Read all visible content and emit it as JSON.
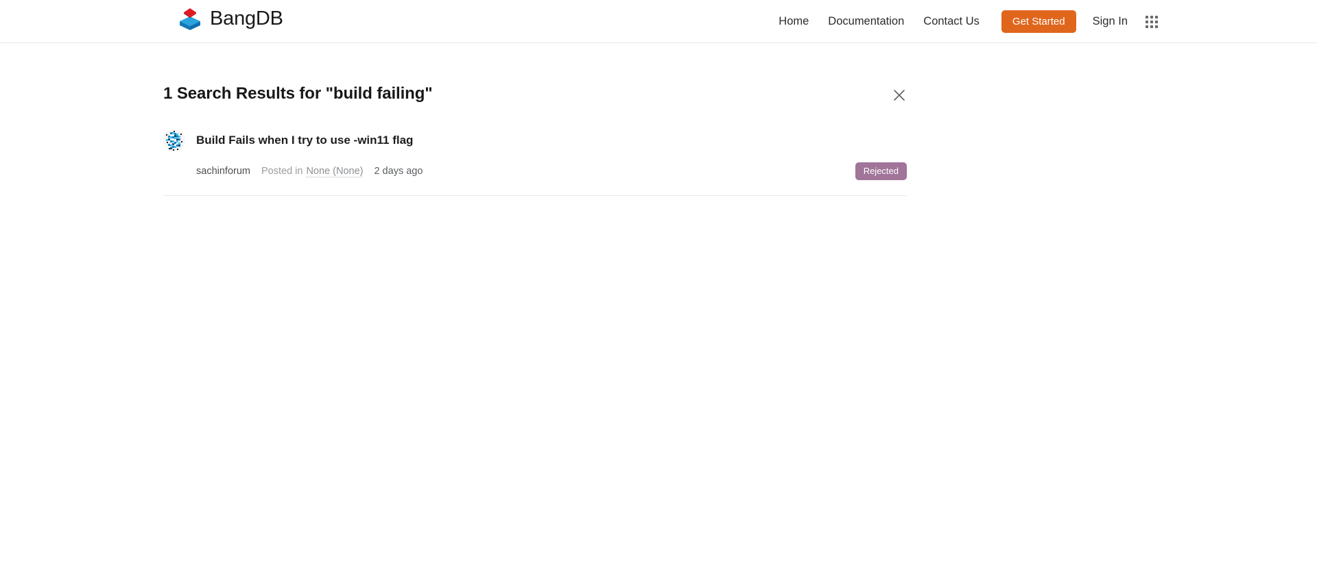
{
  "header": {
    "brand": {
      "name": "BangDB",
      "logo_icon": "bangdb-cube-logo-icon"
    },
    "nav": [
      {
        "label": "Home",
        "name": "nav-link-home"
      },
      {
        "label": "Documentation",
        "name": "nav-link-documentation"
      },
      {
        "label": "Contact Us",
        "name": "nav-link-contact-us"
      }
    ],
    "cta_label": "Get Started",
    "signin_label": "Sign In",
    "apps_icon": "apps-grid-icon",
    "cta_color": "#e0661c"
  },
  "search": {
    "results_heading": "1 Search Results for \"build failing\"",
    "close_icon": "close-icon"
  },
  "results": [
    {
      "avatar_icon": "user-identicon-avatar",
      "title": "Build Fails when I try to use -win11 flag",
      "author": "sachinforum",
      "posted_in_label": "Posted in",
      "category": "None (None)",
      "time": "2 days ago",
      "status": "Rejected",
      "status_color": "#a1749a"
    }
  ]
}
